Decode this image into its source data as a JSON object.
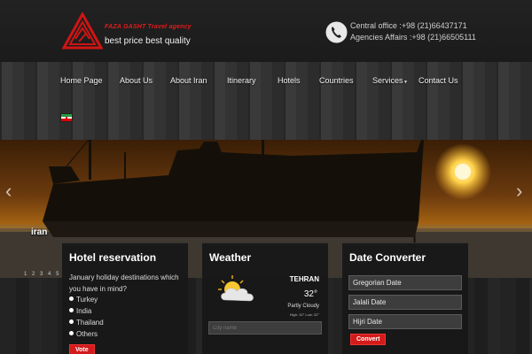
{
  "header": {
    "brand_name": "FAZA GASHT Travel agency",
    "tagline": "best price best quality",
    "central_office": "Central office :+98 (21)66437171",
    "agencies_affairs": "Agencies Affairs :+98 (21)66505111"
  },
  "nav": {
    "items": [
      {
        "label": "Home Page"
      },
      {
        "label": "About Us"
      },
      {
        "label": "About Iran"
      },
      {
        "label": "Itinerary"
      },
      {
        "label": "Hotels"
      },
      {
        "label": "Countries"
      },
      {
        "label": "Services"
      },
      {
        "label": "Contact Us"
      }
    ]
  },
  "slider": {
    "caption": "iran",
    "pages": [
      "1",
      "2",
      "3",
      "4",
      "5"
    ]
  },
  "hotel": {
    "title": "Hotel reservation",
    "question": "January holiday destinations which you have in mind?",
    "options": [
      "Turkey",
      "India",
      "Thailand",
      "Others"
    ],
    "vote_label": "Vote"
  },
  "weather": {
    "title": "Weather",
    "city": "TEHRAN",
    "temp": "32°",
    "condition": "Partly Cloudy",
    "hilo": "High: 32°  Low: 22°",
    "input_placeholder": "City name"
  },
  "converter": {
    "title": "Date Converter",
    "fields": [
      "Gregorian Date",
      "Jalali Date",
      "Hijri Date"
    ],
    "convert_label": "Convert"
  },
  "colors": {
    "accent": "#d31b1b",
    "nav_wood": "#333333",
    "panel_bg": "#181818"
  }
}
